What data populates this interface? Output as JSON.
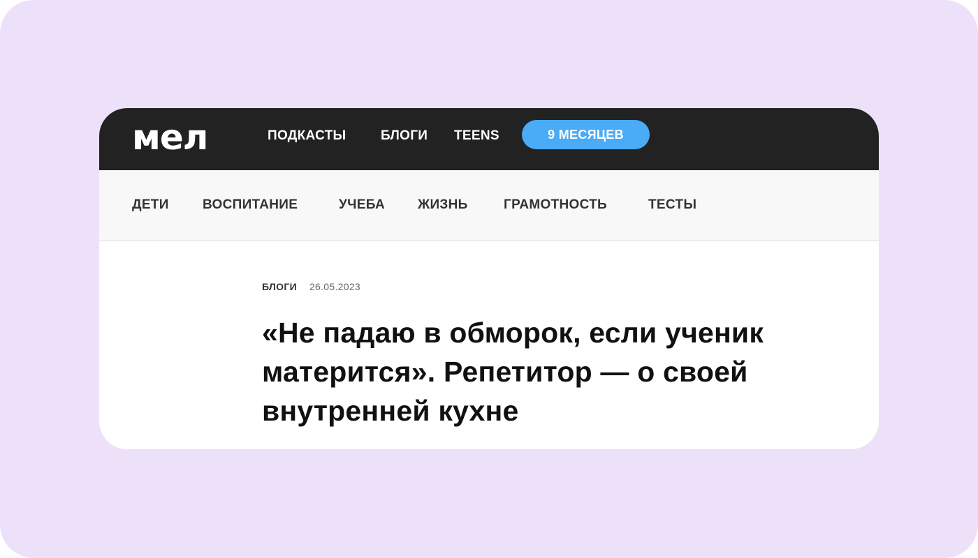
{
  "header": {
    "logo": "мел",
    "nav": [
      {
        "label": "ПОДКАСТЫ"
      },
      {
        "label": "БЛОГИ"
      },
      {
        "label": "TEENS"
      }
    ],
    "promo_label": "9 МЕСЯЦЕВ"
  },
  "subnav": {
    "items": [
      {
        "label": "ДЕТИ"
      },
      {
        "label": "ВОСПИТАНИЕ"
      },
      {
        "label": "УЧЕБА"
      },
      {
        "label": "ЖИЗНЬ"
      },
      {
        "label": "ГРАМОТНОСТЬ"
      },
      {
        "label": "ТЕСТЫ"
      }
    ]
  },
  "article": {
    "category": "БЛОГИ",
    "date": "26.05.2023",
    "title_lines": [
      "«Не падаю в обморок, если ученик",
      "матерится». Репетитор — о своей",
      "внутренней кухне"
    ]
  },
  "colors": {
    "background": "#ede1fa",
    "topbar": "#222222",
    "promo_pill": "#4aabf7",
    "subnav": "#f8f8f8"
  }
}
